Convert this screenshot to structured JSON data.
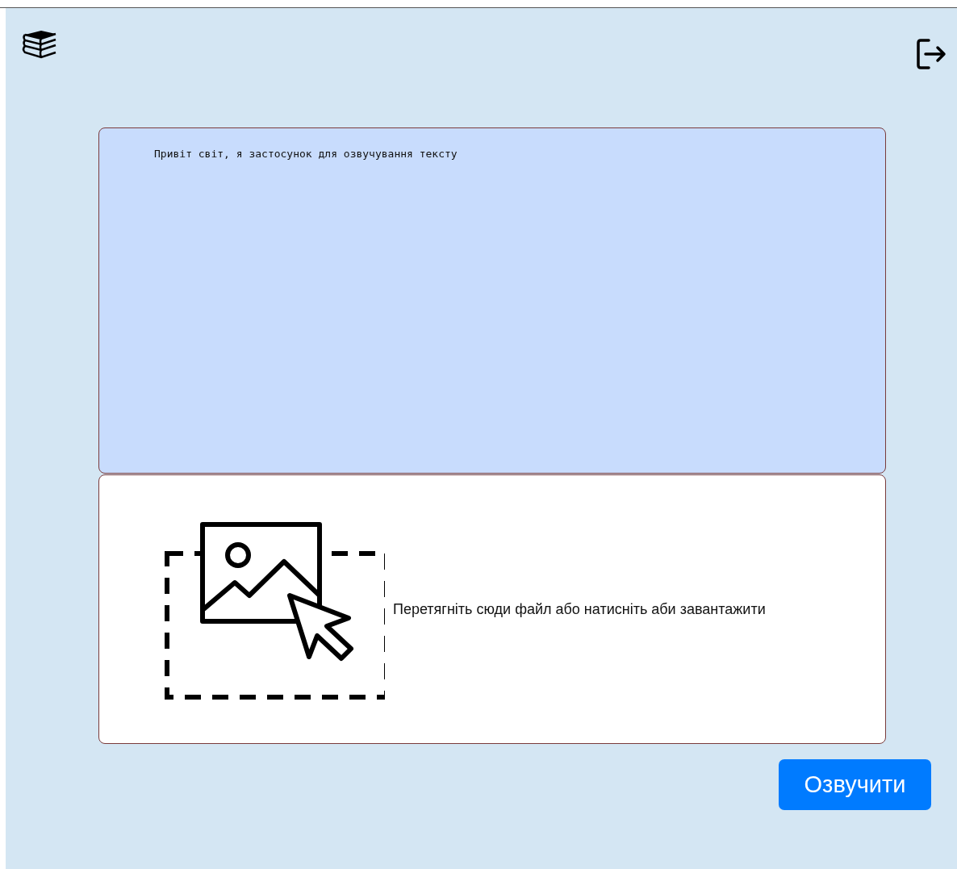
{
  "text_input": {
    "value": "Привіт світ, я застосунок для озвучування тексту"
  },
  "dropzone": {
    "label": "Перетягніть сюди файл або натисніть аби завантажити"
  },
  "button": {
    "label": "Озвучити"
  }
}
